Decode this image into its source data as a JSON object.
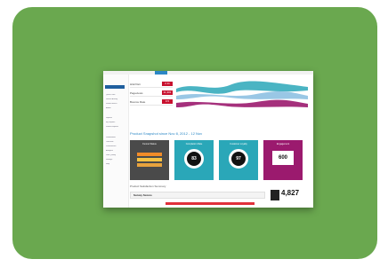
{
  "colors": {
    "background_card": "#6aa84f",
    "screen_bg": "#ffffff",
    "accent_blue": "#2b87c5",
    "tile_dark": "#4a4a4a",
    "tile_teal": "#2aa7b8",
    "tile_purple": "#9b1a6e",
    "red": "#c8102e"
  },
  "header": {
    "active_tab_color": "#2b87c5"
  },
  "sidebar": {
    "items": [
      "Quick Links",
      "Recent Activity",
      "Saved Search",
      "Admin",
      "Reports",
      "My Reports",
      "Shared Reports",
      "Dashboards",
      "Overview",
      "Performance",
      "Analytics",
      "Data Quality",
      "Settings",
      "Help"
    ]
  },
  "metrics": [
    {
      "label": "Hits/Visit",
      "value": "2.11"
    },
    {
      "label": "Pageviews",
      "value": "11,301"
    },
    {
      "label": "Bounce Rate",
      "value": "9.5"
    }
  ],
  "section_title": "Product Snapshot since Nov 8, 2012 - 12 Nov",
  "tiles": [
    {
      "title": "Funnel Status",
      "kind": "bars",
      "bars": [
        "#f28c28",
        "#f6c244",
        "#e8a33d"
      ]
    },
    {
      "title": "Completion Rate",
      "kind": "donut",
      "value": "83"
    },
    {
      "title": "Customer Loyalty",
      "kind": "donut",
      "value": "97"
    },
    {
      "title": "Engagement",
      "kind": "number",
      "value": "600"
    }
  ],
  "footer": {
    "title": "Product Satisfaction Summary",
    "table_title": "Survey Scores",
    "count": "4,827"
  }
}
